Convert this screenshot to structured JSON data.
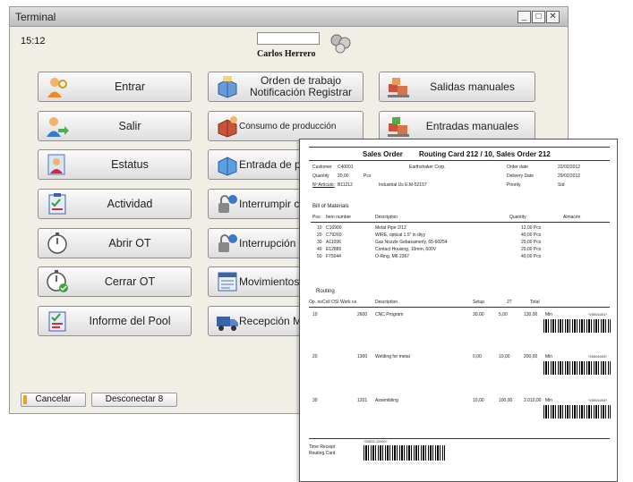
{
  "window": {
    "title": "Terminal",
    "minimize": "_",
    "maximize": "□",
    "close": "✕"
  },
  "header": {
    "time": "15:12",
    "user": "Carlos Herrero",
    "user_icon": "users-icon"
  },
  "left_buttons": [
    {
      "label": "Entrar",
      "icon": "key-user-icon"
    },
    {
      "label": "Salir",
      "icon": "user-exit-icon"
    },
    {
      "label": "Estatus",
      "icon": "status-user-icon"
    },
    {
      "label": "Actividad",
      "icon": "activity-clipboard-icon"
    },
    {
      "label": "Abrir OT",
      "icon": "stopwatch-icon"
    },
    {
      "label": "Cerrar OT",
      "icon": "stopwatch-check-icon"
    },
    {
      "label": "Informe del Pool",
      "icon": "pool-report-icon"
    }
  ],
  "middle_buttons": [
    {
      "label1": "Orden de trabajo",
      "label2": "Notificación Registrar",
      "icon": "box-order-icon"
    },
    {
      "label1": "Consumo de producción",
      "label2": "",
      "icon": "consumption-icon"
    },
    {
      "label1": "Entrada de pro",
      "label2": "",
      "icon": "production-entry-icon"
    },
    {
      "label1": "Interrumpir c",
      "label2": "",
      "icon": "interrupt-icon"
    },
    {
      "label1": "Interrupción",
      "label2": "",
      "icon": "interruption-icon"
    },
    {
      "label1": "Movimientos",
      "label2": "",
      "icon": "movements-icon"
    },
    {
      "label1": "Recepción Me",
      "label2": "",
      "icon": "truck-icon"
    }
  ],
  "right_buttons": [
    {
      "label": "Salidas manuales",
      "icon": "goods-out-icon"
    },
    {
      "label": "Entradas manuales",
      "icon": "goods-in-icon"
    }
  ],
  "footer": {
    "cancel": "Cancelar",
    "disconnect": "Desconectar 8"
  },
  "document": {
    "title_left": "Sales Order",
    "title_right": "Routing Card 212 / 10,  Sales Order 212",
    "info_left": [
      {
        "k": "Customer",
        "v": "C40001",
        "extra": "Earthshaker Corp."
      },
      {
        "k": "Quantity",
        "v": "20,00",
        "extra": "Pcs"
      },
      {
        "k": "Nº Artículo:",
        "v": "B11212",
        "extra": "Industrial Us E.M-52157"
      }
    ],
    "info_right": [
      {
        "k": "Order date",
        "v": "22/02/2012"
      },
      {
        "k": "Delivery Date",
        "v": "29/02/2012"
      },
      {
        "k": "Priority",
        "v": "Std"
      }
    ],
    "bom_title": "Bill of Materials",
    "bom_headers": [
      "Pos",
      "Item number",
      "Description",
      "Quantity",
      "Almacén"
    ],
    "bom_rows": [
      [
        "10",
        "C16900",
        "Metal Pipe 2/12",
        "12,00 Pcs"
      ],
      [
        "20",
        "C79260",
        "WIRE, optical 1.5\" in diyy",
        "40,00 Pcs"
      ],
      [
        "30",
        "A11096",
        "Gas Nozzle Gebaxamerly, 65-60254",
        "20,00 Pcs"
      ],
      [
        "40",
        "E12886",
        "Contact Housing, 10mm, 600V",
        "20,00 Pcs"
      ],
      [
        "50",
        "F75044",
        "O-Ring, M6 2367",
        "40,00 Pcs"
      ]
    ],
    "routing_title": "Routing",
    "routing_headers": [
      "Op. no",
      "Coll OSI Work ce",
      "Description",
      "Setup",
      "JT",
      "Total"
    ],
    "routing_rows": [
      {
        "op": "10",
        "wc": "2600",
        "desc": "CNC Program",
        "setup": "30,00",
        "jt": "5,00",
        "total": "130,00",
        "unit": "Min",
        "code": "*20001001*"
      },
      {
        "op": "20",
        "wc": "1300",
        "desc": "Welding for metal",
        "setup": "0,00",
        "jt": "10,00",
        "total": "200,00",
        "unit": "Min",
        "code": "*20001003*"
      },
      {
        "op": "30",
        "wc": "1201",
        "desc": "Assembling",
        "setup": "10,00",
        "jt": "100,00",
        "total": "2.010,00",
        "unit": "Min",
        "code": "*20001003*"
      }
    ],
    "receipt_label1": "Time Receipt",
    "receipt_label2": "Routing Card",
    "receipt_code": "*20002-12001*"
  },
  "colors": {
    "window_bg": "#f1eee6",
    "button_border": "#8f8f8f",
    "cancel_mark": "#f0a020"
  }
}
